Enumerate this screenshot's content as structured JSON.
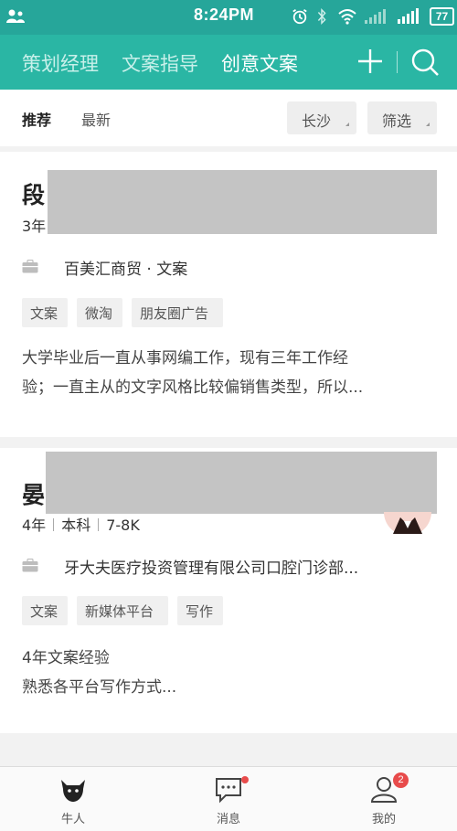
{
  "status_bar": {
    "time": "8:24PM",
    "battery": "77",
    "icons": [
      "user-icon",
      "alarm-icon",
      "bluetooth-icon",
      "wifi-icon",
      "signal-icon",
      "signal-icon",
      "battery-icon"
    ]
  },
  "nav": {
    "tabs": [
      {
        "label": "策划经理"
      },
      {
        "label": "文案指导"
      },
      {
        "label": "创意文案"
      }
    ],
    "active_tab": "创意文案",
    "add_icon": "plus-icon",
    "search_icon": "search-icon"
  },
  "filter": {
    "tabs": [
      {
        "label": "推荐"
      },
      {
        "label": "最新"
      }
    ],
    "city": "长沙",
    "filter_label": "筛选"
  },
  "cards": [
    {
      "name": "段",
      "meta": "3年",
      "company": "百美汇商贸 · 文案",
      "tags": [
        "文案",
        "微淘",
        "朋友圈广告"
      ],
      "desc_lines": [
        "大学毕业后一直从事网编工作，现有三年工作经",
        "验；一直主从的文字风格比较偏销售类型，所以..."
      ]
    },
    {
      "name": "晏",
      "meta": [
        "4年",
        "本科",
        "7-8K"
      ],
      "company": "牙大夫医疗投资管理有限公司口腔门诊部...",
      "tags": [
        "文案",
        "新媒体平台",
        "写作"
      ],
      "desc_lines": [
        "4年文案经验",
        "熟悉各平台写作方式..."
      ]
    }
  ],
  "bottom_nav": {
    "items": [
      {
        "label": "牛人",
        "icon": "bull-icon"
      },
      {
        "label": "消息",
        "icon": "message-icon"
      },
      {
        "label": "我的",
        "icon": "profile-icon",
        "badge": "2"
      }
    ]
  },
  "colors": {
    "accent": "#2ab6a4",
    "status_bar": "#26a69a",
    "badge": "#e84b4b"
  }
}
